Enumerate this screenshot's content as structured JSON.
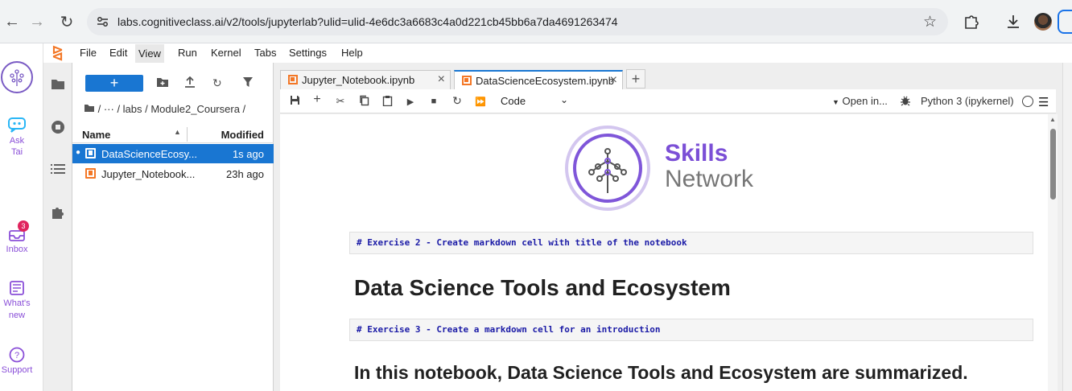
{
  "browser": {
    "url": "labs.cognitiveclass.ai/v2/tools/jupyterlab?ulid=ulid-4e6dc3a6683c4a0d221cb45bb6a7da4691263474"
  },
  "site_sidebar": {
    "ask_tai": "Ask Tai",
    "inbox": "Inbox",
    "inbox_badge": "3",
    "whats_new": "What's new",
    "support": "Support"
  },
  "menubar": {
    "items": [
      "File",
      "Edit",
      "View",
      "Run",
      "Kernel",
      "Tabs",
      "Settings",
      "Help"
    ]
  },
  "filebrowser": {
    "new_label": "+",
    "breadcrumb": "/  ···  / labs / Module2_Coursera /",
    "col_name": "Name",
    "col_modified": "Modified",
    "files": [
      {
        "name": "DataScienceEcosystem.ipynb",
        "display": "DataScienceEcosy...",
        "modified": "1s ago",
        "selected": true
      },
      {
        "name": "Jupyter_Notebook.ipynb",
        "display": "Jupyter_Notebook...",
        "modified": "23h ago",
        "selected": false
      }
    ]
  },
  "tabs": [
    {
      "label": "Jupyter_Notebook.ipynb",
      "active": false
    },
    {
      "label": "DataScienceEcosystem.ipynb",
      "active": true
    }
  ],
  "toolbar": {
    "cell_type": "Code",
    "open_in": "Open in...",
    "kernel": "Python 3 (ipykernel)"
  },
  "notebook": {
    "logo_line1": "Skills",
    "logo_line2": "Network",
    "cells": [
      {
        "type": "raw",
        "text": "# Exercise 2 - Create markdown cell with title of the notebook"
      },
      {
        "type": "h1",
        "text": "Data Science Tools and Ecosystem"
      },
      {
        "type": "raw",
        "text": "# Exercise 3 - Create a markdown cell for an introduction"
      },
      {
        "type": "h2",
        "text": "In this notebook, Data Science Tools and Ecosystem are summarized."
      }
    ]
  },
  "colors": {
    "accent": "#1976d2",
    "jupyter_orange": "#f37726",
    "brand_purple": "#7b4fd6"
  }
}
